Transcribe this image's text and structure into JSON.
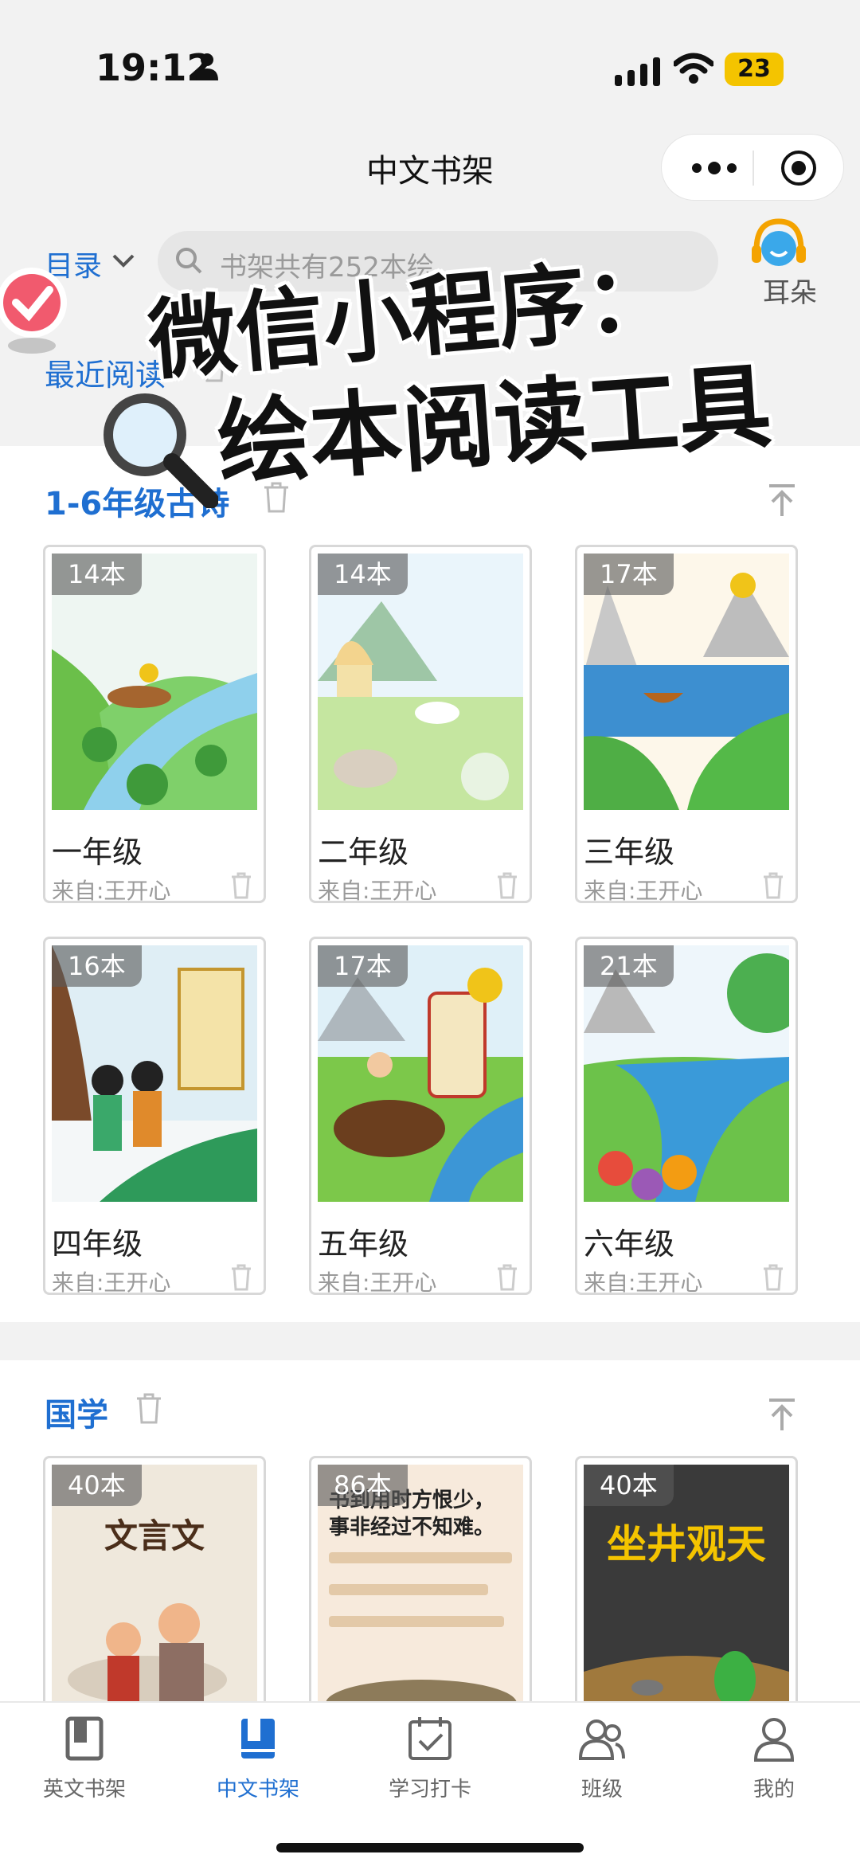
{
  "status_bar": {
    "time": "19:12",
    "battery": "23"
  },
  "nav": {
    "title": "中文书架"
  },
  "toolbar": {
    "menu_label": "目录",
    "search_placeholder": "书架共有252本绘",
    "ear_label": "耳朵"
  },
  "recent": {
    "label": "最近阅读"
  },
  "sections": [
    {
      "title": "1-6年级古诗",
      "books": [
        {
          "count": "14本",
          "title": "一年级",
          "from": "来自:王开心"
        },
        {
          "count": "14本",
          "title": "二年级",
          "from": "来自:王开心"
        },
        {
          "count": "17本",
          "title": "三年级",
          "from": "来自:王开心"
        },
        {
          "count": "16本",
          "title": "四年级",
          "from": "来自:王开心"
        },
        {
          "count": "17本",
          "title": "五年级",
          "from": "来自:王开心"
        },
        {
          "count": "21本",
          "title": "六年级",
          "from": "来自:王开心"
        }
      ]
    },
    {
      "title": "国学",
      "books": [
        {
          "count": "40本",
          "cover_text": "文言文"
        },
        {
          "count": "86本",
          "cover_text": "书到用时方恨少，事非经过不知难。"
        },
        {
          "count": "40本",
          "cover_text": "坐井观天"
        }
      ]
    }
  ],
  "promo": {
    "line1": "微信小程序：",
    "line2": "绘本阅读工具"
  },
  "tabs": [
    {
      "label": "英文书架",
      "icon": "book-icon"
    },
    {
      "label": "中文书架",
      "icon": "book-filled-icon",
      "active": true
    },
    {
      "label": "学习打卡",
      "icon": "calendar-check-icon"
    },
    {
      "label": "班级",
      "icon": "group-icon"
    },
    {
      "label": "我的",
      "icon": "user-icon"
    }
  ],
  "colors": {
    "accent": "#1f6fd1",
    "battery": "#f4c400"
  }
}
